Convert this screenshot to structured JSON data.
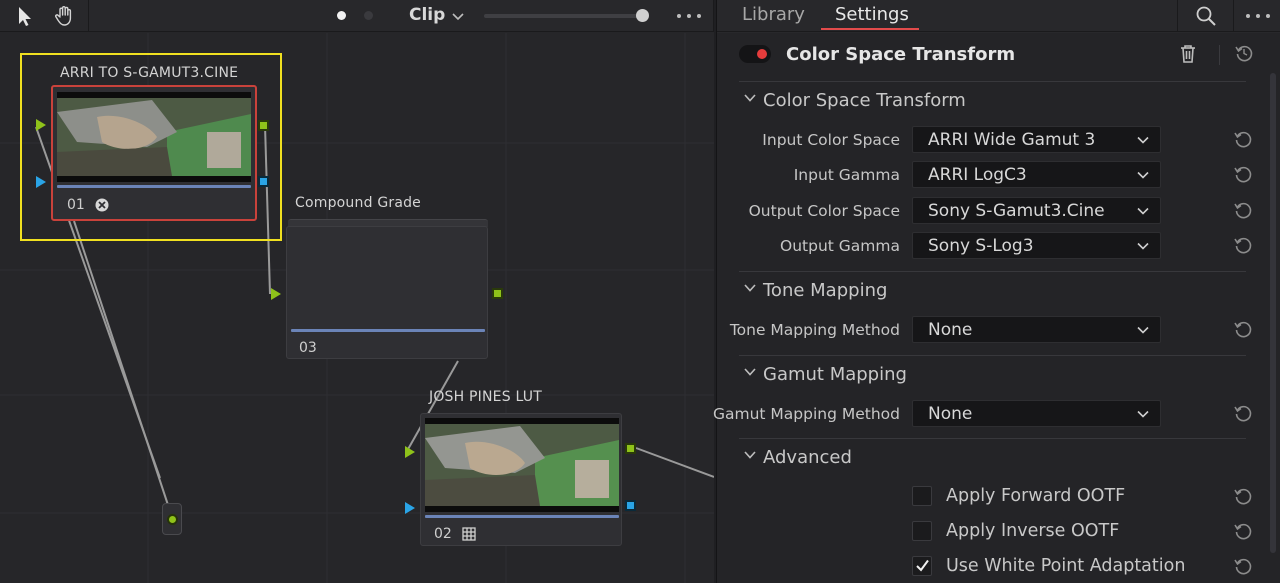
{
  "node_toolbar": {
    "clip_label": "Clip",
    "icons": [
      "pointer-icon",
      "hand-icon",
      "chevron-down-icon",
      "more-icon"
    ]
  },
  "nodes": [
    {
      "id": "01",
      "label": "ARRI TO S-GAMUT3.CINE",
      "number": "01",
      "badge": "fx-badge-icon",
      "selected": true
    },
    {
      "id": "03",
      "label": "Compound  Grade",
      "number": "03"
    },
    {
      "id": "02",
      "label": "JOSH PINES LUT",
      "number": "02",
      "badge": "lut-grid-icon"
    }
  ],
  "settings": {
    "tabs": [
      {
        "label": "Library",
        "active": false
      },
      {
        "label": "Settings",
        "active": true
      }
    ],
    "fx_title": "Color Space Transform",
    "sections": {
      "csT": "Color Space Transform",
      "tone": "Tone Mapping",
      "gamut": "Gamut Mapping",
      "advanced": "Advanced"
    },
    "rows": {
      "input_cs": {
        "label": "Input Color Space",
        "value": "ARRI Wide Gamut 3"
      },
      "input_gamma": {
        "label": "Input Gamma",
        "value": "ARRI LogC3"
      },
      "output_cs": {
        "label": "Output Color Space",
        "value": "Sony S-Gamut3.Cine"
      },
      "output_gamma": {
        "label": "Output Gamma",
        "value": "Sony S-Log3"
      },
      "tone_method": {
        "label": "Tone Mapping Method",
        "value": "None"
      },
      "gamut_method": {
        "label": "Gamut Mapping Method",
        "value": "None"
      }
    },
    "checkboxes": {
      "fwd_ootf": {
        "label": "Apply Forward OOTF",
        "checked": false
      },
      "inv_ootf": {
        "label": "Apply Inverse OOTF",
        "checked": false
      },
      "wpa": {
        "label": "Use White Point Adaptation",
        "checked": true
      }
    }
  },
  "colors": {
    "accent_red": "#e24b4b",
    "selection_yellow": "#f0e020",
    "port_green": "#8fc21a",
    "port_blue": "#2aa4e6",
    "node_border_red": "#c9423b"
  }
}
